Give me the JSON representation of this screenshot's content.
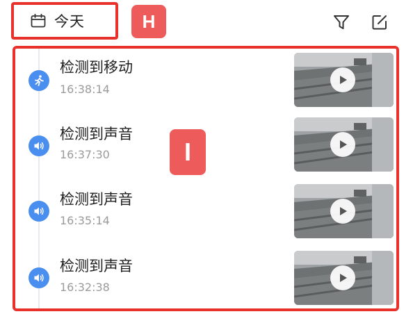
{
  "header": {
    "date_label": "今天",
    "icons": [
      "calendar-icon",
      "filter-icon",
      "edit-icon"
    ]
  },
  "annotations": {
    "badge_h": "H",
    "badge_i": "I"
  },
  "colors": {
    "accent_blue": "#4a8ff0",
    "highlight_red": "#e8312b",
    "badge_red": "#ee5b5b"
  },
  "events": [
    {
      "title": "检测到移动",
      "time": "16:38:14",
      "icon": "motion-icon"
    },
    {
      "title": "检测到声音",
      "time": "16:37:30",
      "icon": "sound-icon"
    },
    {
      "title": "检测到声音",
      "time": "16:35:14",
      "icon": "sound-icon"
    },
    {
      "title": "检测到声音",
      "time": "16:32:38",
      "icon": "sound-icon"
    }
  ]
}
